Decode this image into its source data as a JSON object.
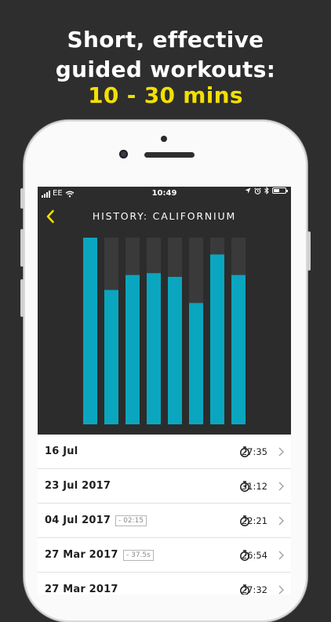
{
  "headline": {
    "line1": "Short, effective",
    "line2": "guided workouts:",
    "line3": "10 - 30 mins"
  },
  "status_bar": {
    "carrier": "EE",
    "time": "10:49",
    "icons": [
      "signal-icon",
      "wifi-icon",
      "location-icon",
      "alarm-icon",
      "bluetooth-icon",
      "battery-icon"
    ]
  },
  "nav": {
    "back_icon": "chevron-left-icon",
    "title": "HISTORY: CALIFORNIUM"
  },
  "colors": {
    "accent": "#f3e000",
    "bar": "#0aa6bf",
    "bar_track": "#3a3a3a",
    "screen_bg": "#2c2c2c"
  },
  "chart_data": {
    "type": "bar",
    "values": [
      1.0,
      0.72,
      0.8,
      0.81,
      0.79,
      0.65,
      0.91,
      0.8
    ],
    "ylim": [
      0,
      1
    ],
    "grid": false
  },
  "history": [
    {
      "date": "16 Jul",
      "badge": "",
      "duration": "27:35"
    },
    {
      "date": "23 Jul 2017",
      "badge": "",
      "duration": "31:12"
    },
    {
      "date": "04 Jul 2017",
      "badge": "- 02:15",
      "duration": "22:21"
    },
    {
      "date": "27 Mar 2017",
      "badge": "- 37.5s",
      "duration": "26:54"
    },
    {
      "date": "27 Mar 2017",
      "badge": "",
      "duration": "27:32"
    }
  ]
}
